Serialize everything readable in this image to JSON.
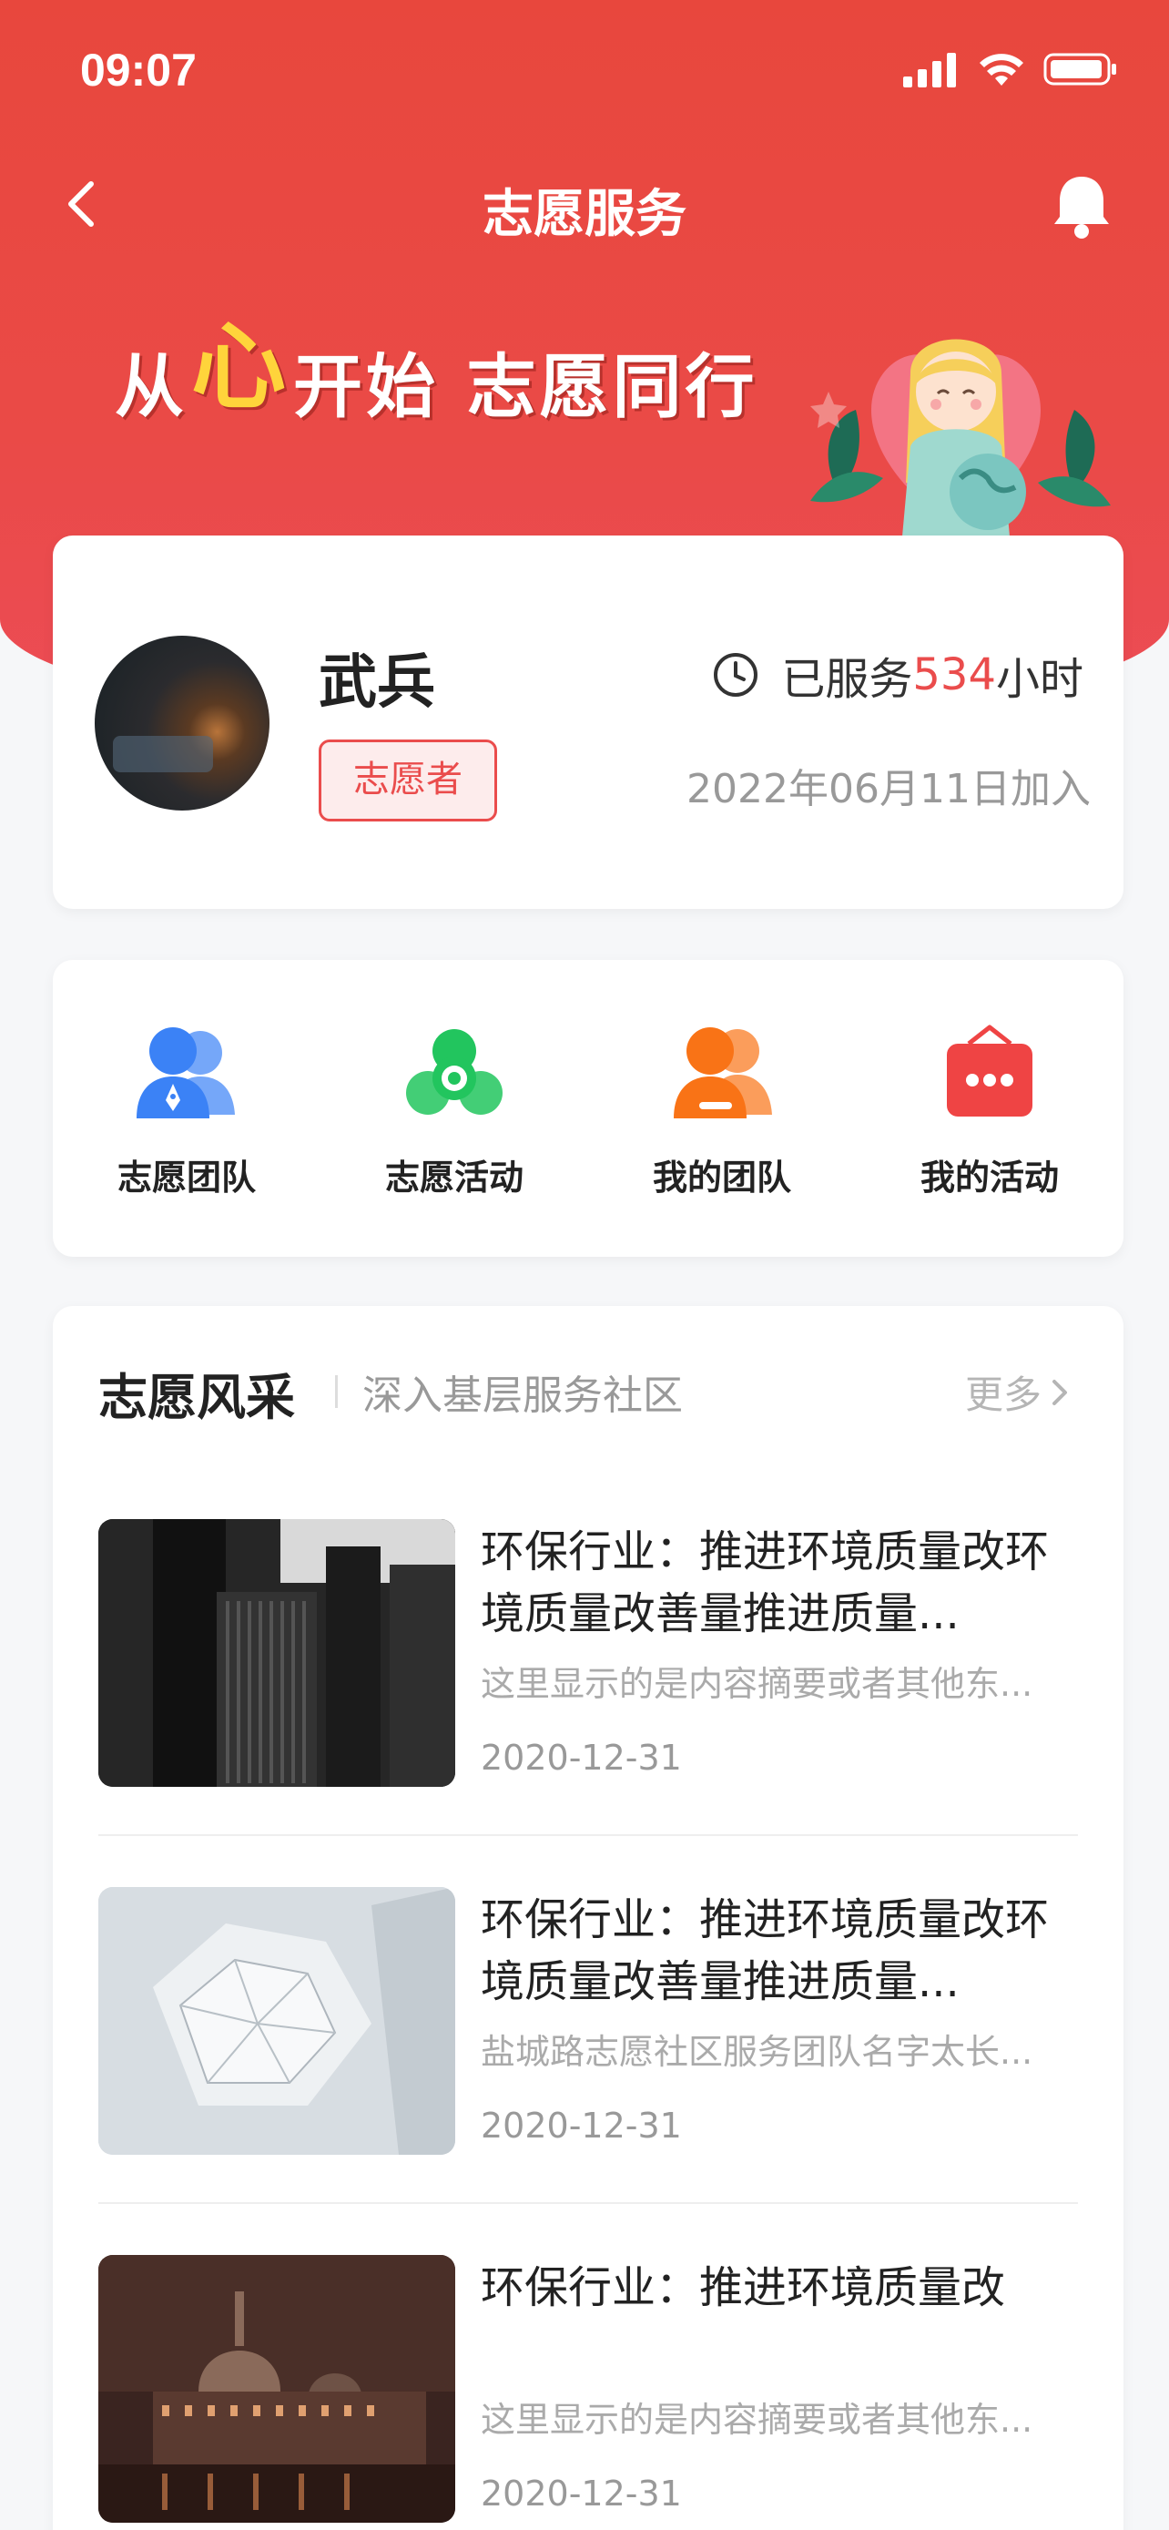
{
  "status_bar": {
    "time": "09:07"
  },
  "nav": {
    "title": "志愿服务"
  },
  "banner": {
    "slogan_part1": "从",
    "slogan_heart": "心",
    "slogan_part2": "开始  志愿同行"
  },
  "profile": {
    "name": "武兵",
    "role": "志愿者",
    "hours_prefix": "已服务 ",
    "hours_value": "534",
    "hours_suffix": "小时",
    "joined": "2022年06月11日加入"
  },
  "menu": [
    {
      "label": "志愿团队",
      "icon": "team-icon",
      "color": "#3b82f6"
    },
    {
      "label": "志愿活动",
      "icon": "activity-icon",
      "color": "#22c55e"
    },
    {
      "label": "我的团队",
      "icon": "my-team-icon",
      "color": "#f97316"
    },
    {
      "label": "我的活动",
      "icon": "my-activity-icon",
      "color": "#ef4444"
    }
  ],
  "news_section": {
    "title": "志愿风采",
    "subtitle": "深入基层服务社区",
    "more": "更多",
    "items": [
      {
        "title": "环保行业：推进环境质量改环境质量改善量推进质量...",
        "summary": "这里显示的是内容摘要或者其他东...",
        "date": "2020-12-31"
      },
      {
        "title": "环保行业：推进环境质量改环境质量改善量推进质量...",
        "summary": "盐城路志愿社区服务团队名字太长...",
        "date": "2020-12-31"
      },
      {
        "title": "环保行业：推进环境质量改",
        "summary": "这里显示的是内容摘要或者其他东...",
        "date": "2020-12-31"
      }
    ]
  },
  "colors": {
    "accent": "#e8473d",
    "highlight": "#ea4c4c"
  }
}
